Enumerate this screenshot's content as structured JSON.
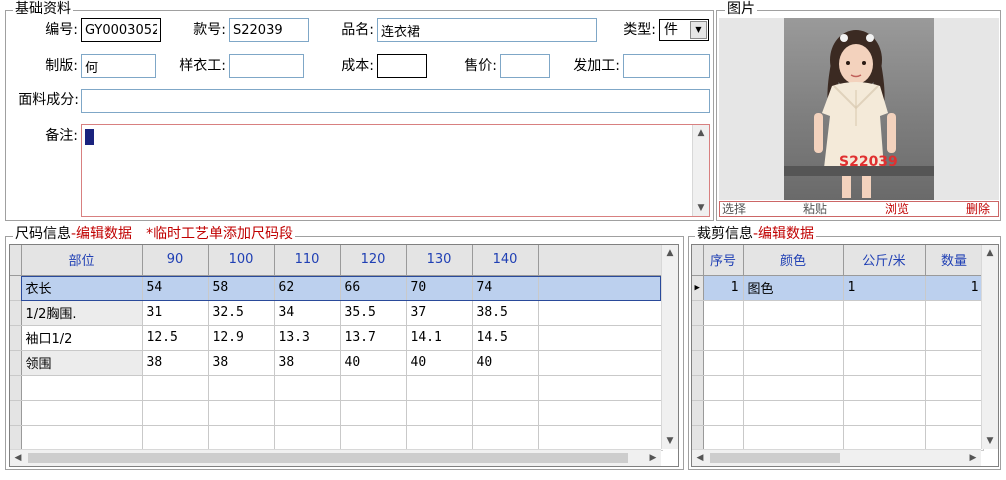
{
  "basic": {
    "legend": "基础资料",
    "labels": {
      "code": "编号:",
      "style_no": "款号:",
      "product_name": "品名:",
      "type": "类型:",
      "pattern_maker": "制版:",
      "sample_worker": "样衣工:",
      "cost": "成本:",
      "price": "售价:",
      "processor": "发加工:",
      "fabric": "面料成分:",
      "remark": "备注:"
    },
    "values": {
      "code": "GY0003052",
      "style_no": "S22039",
      "product_name": "连衣裙",
      "type": "件",
      "pattern_maker": "何",
      "sample_worker": "",
      "cost": "",
      "price": "",
      "processor": "",
      "fabric": "",
      "remark": ""
    }
  },
  "photo": {
    "legend": "图片",
    "watermark": "S22039",
    "buttons": {
      "select": "选择",
      "paste": "粘贴",
      "browse": "浏览",
      "delete": "删除"
    }
  },
  "size": {
    "legend_main": "尺码信息",
    "legend_edit": "-编辑数据",
    "legend_note": "*临时工艺单添加尺码段",
    "headers": [
      "部位",
      "90",
      "100",
      "110",
      "120",
      "130",
      "140"
    ],
    "rows": [
      [
        "衣长",
        "54",
        "58",
        "62",
        "66",
        "70",
        "74"
      ],
      [
        "1/2胸围.",
        "31",
        "32.5",
        "34",
        "35.5",
        "37",
        "38.5"
      ],
      [
        "袖口1/2",
        "12.5",
        "12.9",
        "13.3",
        "13.7",
        "14.1",
        "14.5"
      ],
      [
        "领围",
        "38",
        "38",
        "38",
        "40",
        "40",
        "40"
      ]
    ]
  },
  "cut": {
    "legend_main": "裁剪信息",
    "legend_edit": "-编辑数据",
    "headers": [
      "序号",
      "颜色",
      "公斤/米",
      "数量"
    ],
    "rows": [
      [
        "1",
        "图色",
        "1",
        "1"
      ]
    ]
  },
  "colors": {
    "accent_red": "#c00000",
    "header_text": "#1f3fb4",
    "selected_row": "#bcd0ee"
  }
}
